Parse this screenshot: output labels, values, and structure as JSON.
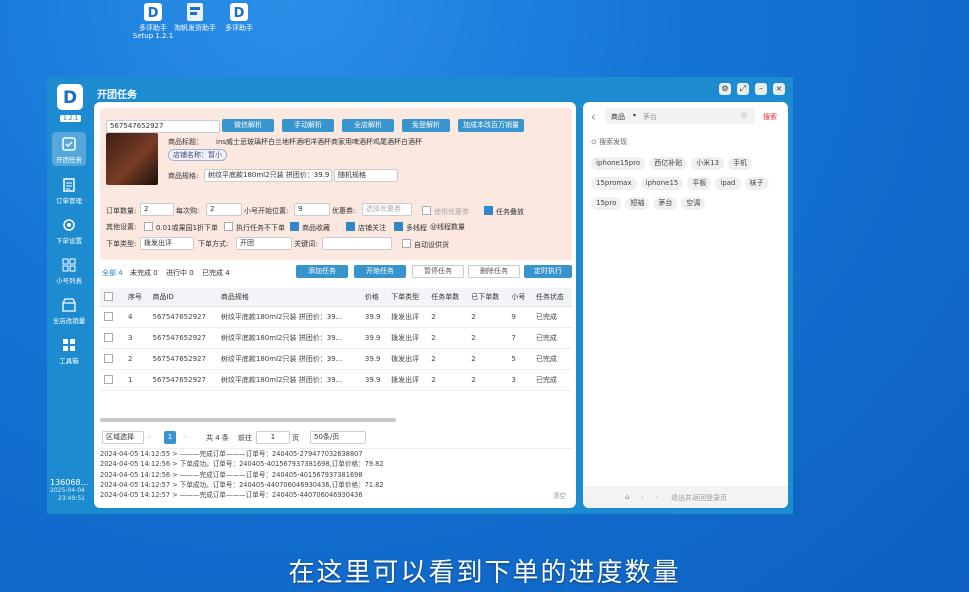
{
  "desktop": {
    "icons": [
      {
        "label": "多评助手\nSetup 1.2.1"
      },
      {
        "label": "淘帆发货助手"
      },
      {
        "label": "多评助手"
      }
    ]
  },
  "subtitle": "在这里可以看到下单的进度数量",
  "window": {
    "title": "开团任务",
    "version": "1.2.1",
    "controls": [
      "⚙",
      "⤢",
      "–",
      "×"
    ]
  },
  "sidebar": {
    "items": [
      {
        "label": "开团任务",
        "icon": "checkbox-icon"
      },
      {
        "label": "订单管理",
        "icon": "document-icon"
      },
      {
        "label": "下单设置",
        "icon": "gear-icon"
      },
      {
        "label": "小号列表",
        "icon": "grid-icon"
      },
      {
        "label": "全店改销量",
        "icon": "store-icon"
      },
      {
        "label": "工具箱",
        "icon": "toolbox-icon"
      }
    ],
    "footer_id": "136068…",
    "footer_date": "2025-04-04",
    "footer_time": "23:49:51"
  },
  "product": {
    "id_value": "567547652927",
    "parse_buttons": [
      "微信解析",
      "手动解析",
      "全店解析",
      "免登解析",
      "加成本改百万销量"
    ],
    "title_label": "商品标题：",
    "title_value": "ins威士忌玻璃杯白兰地杯酒吧洋酒杯商家用啤酒杯鸡尾酒杯白酒杯",
    "shop_tag": "店铺名称：暂小",
    "spec_label": "商品规格:",
    "spec_value": "树纹平底款180ml2只装 拼团价：39.9",
    "random_spec": "随机规格"
  },
  "form": {
    "order_qty_label": "订单数量:",
    "order_qty": "2",
    "per_buy_label": "每次购:",
    "per_buy": "2",
    "start_pos_label": "小号开始位置:",
    "start_pos": "9",
    "coupon_label": "优惠券:",
    "coupon_placeholder": "选择优惠券",
    "use_coupon": "使用优惠券",
    "task_stack": "任务叠放",
    "other_label": "其他设置:",
    "opt1": "0.01或果园1折下单",
    "opt2": "执行任务不下单",
    "opt3": "商品收藏",
    "opt4": "店铺关注",
    "opt5": "多线程",
    "opt6": "@线程数量",
    "order_type_label": "下单类型:",
    "order_type": "拨发出评",
    "order_mode_label": "下单方式:",
    "order_mode": "开团",
    "keyword_label": "关键词:",
    "auto_ship": "自动设供货"
  },
  "status": {
    "all": "全部 4",
    "incomplete": "未完成 0",
    "running": "进行中 0",
    "done": "已完成 4"
  },
  "actions": [
    "添加任务",
    "开始任务",
    "暂停任务",
    "删除任务",
    "定时执行"
  ],
  "table": {
    "headers": [
      "序号",
      "商品ID",
      "商品规格",
      "价格",
      "下单类型",
      "任务单数",
      "已下单数",
      "小号",
      "任务状态"
    ],
    "rows": [
      [
        "4",
        "567547652927",
        "树纹平底款180ml2只装 拼团价：39...",
        "39.9",
        "拨发出评",
        "2",
        "2",
        "9",
        "已完成"
      ],
      [
        "3",
        "567547652927",
        "树纹平底款180ml2只装 拼团价：39...",
        "39.9",
        "拨发出评",
        "2",
        "2",
        "7",
        "已完成"
      ],
      [
        "2",
        "567547652927",
        "树纹平底款180ml2只装 拼团价：39...",
        "39.9",
        "拨发出评",
        "2",
        "2",
        "5",
        "已完成"
      ],
      [
        "1",
        "567547652927",
        "树纹平底款180ml2只装 拼团价：39...",
        "39.9",
        "拨发出评",
        "2",
        "2",
        "3",
        "已完成"
      ]
    ]
  },
  "pagination": {
    "region": "区域选择",
    "current": "1",
    "total": "共 4 条",
    "goto": "前往",
    "page_input": "1",
    "page_suffix": "页",
    "page_size": "50条/页"
  },
  "log": {
    "lines": [
      "2024-04-05 14:12:55 > ———完成订单———订单号：240405-279477032638807",
      "2024-04-05 14:12:56 > 下单成功。订单号：240405-401567937381698,订单价格：79.82",
      "2024-04-05 14:12:56 > ———完成订单———订单号：240405-401567937381698",
      "2024-04-05 14:12:57 > 下单成功。订单号：240405-440706046930436,订单价格：71.82",
      "2024-04-05 14:12:57 > ———完成订单———订单号：240405-440706046930436"
    ],
    "clear": "清空"
  },
  "right_panel": {
    "category": "商品",
    "search_placeholder": "茅台",
    "search_button": "搜索",
    "discover_label": "搜索发现",
    "chips": [
      "iphone15pro",
      "西亿补贴",
      "小米13",
      "手机",
      "15promax",
      "iphone15",
      "平板",
      "ipad",
      "袜子",
      "15pro",
      "短袖",
      "茅台",
      "空调"
    ],
    "bottom_link": "退出并返回登录页"
  }
}
